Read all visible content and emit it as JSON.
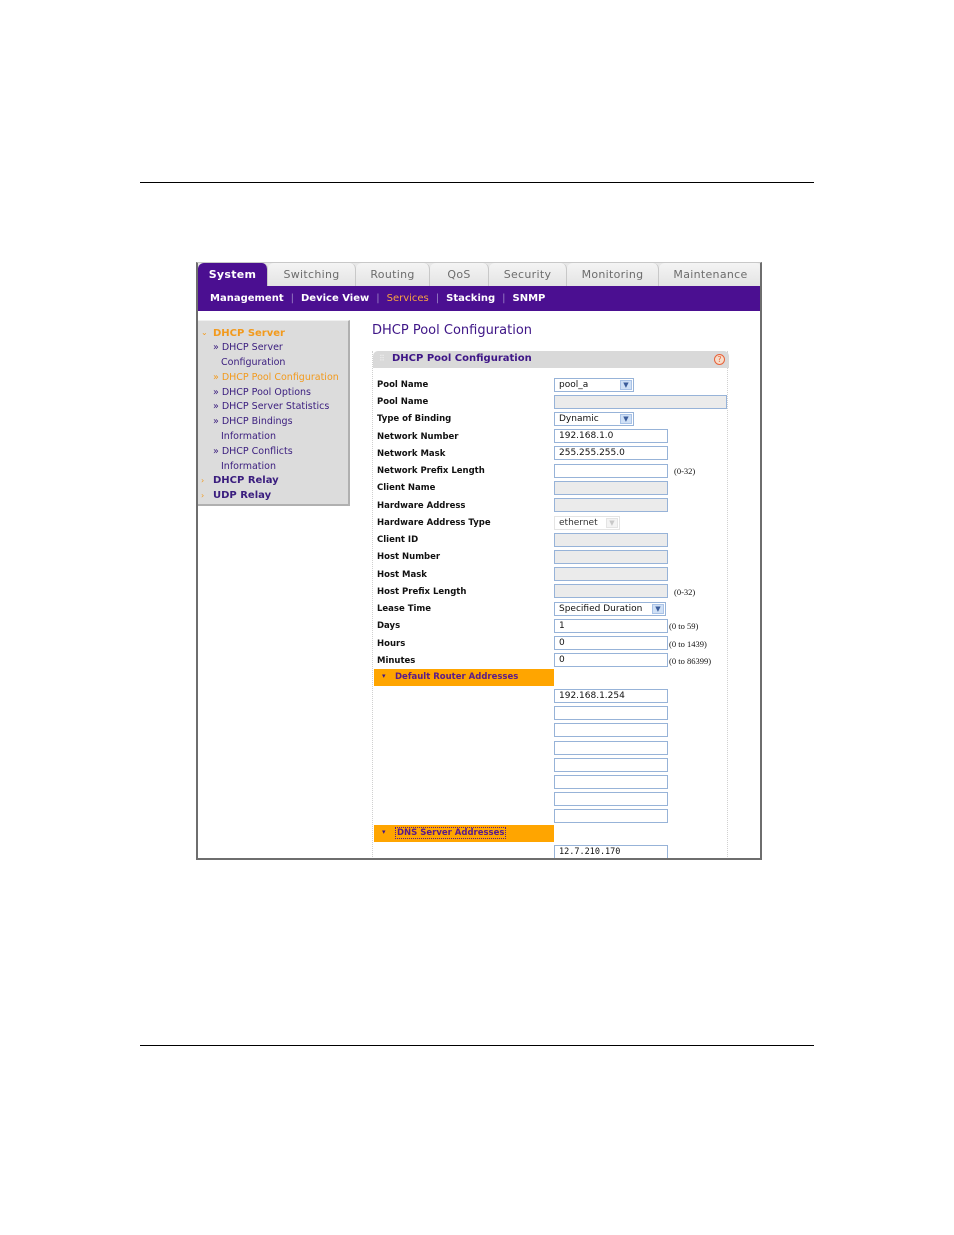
{
  "tabs": [
    {
      "label": "System",
      "active": true
    },
    {
      "label": "Switching",
      "active": false
    },
    {
      "label": "Routing",
      "active": false
    },
    {
      "label": "QoS",
      "active": false
    },
    {
      "label": "Security",
      "active": false
    },
    {
      "label": "Monitoring",
      "active": false
    },
    {
      "label": "Maintenance",
      "active": false
    }
  ],
  "subnav": [
    {
      "label": "Management",
      "active": false
    },
    {
      "label": "Device View",
      "active": false
    },
    {
      "label": "Services",
      "active": true
    },
    {
      "label": "Stacking",
      "active": false
    },
    {
      "label": "SNMP",
      "active": false
    }
  ],
  "sidebar": {
    "dhcp_server": "DHCP Server",
    "items": [
      {
        "label": "» DHCP Server"
      },
      {
        "label": "Configuration"
      },
      {
        "label": "» DHCP Pool Configuration"
      },
      {
        "label": "» DHCP Pool Options"
      },
      {
        "label": "» DHCP Server Statistics"
      },
      {
        "label": "» DHCP Bindings"
      },
      {
        "label": "Information"
      },
      {
        "label": "» DHCP Conflicts"
      },
      {
        "label": "Information"
      }
    ],
    "dhcp_relay": "DHCP Relay",
    "udp_relay": "UDP Relay"
  },
  "content": {
    "page_title": "DHCP Pool Configuration",
    "panel_title": "DHCP Pool Configuration",
    "help": "?",
    "fields": {
      "pool_name_select": {
        "label": "Pool Name",
        "value": "pool_a"
      },
      "pool_name_input": {
        "label": "Pool Name",
        "value": ""
      },
      "type_of_binding": {
        "label": "Type of Binding",
        "value": "Dynamic"
      },
      "network_number": {
        "label": "Network Number",
        "value": "192.168.1.0"
      },
      "network_mask": {
        "label": "Network Mask",
        "value": "255.255.255.0"
      },
      "network_prefix_length": {
        "label": "Network Prefix Length",
        "value": "",
        "hint": "(0-32)"
      },
      "client_name": {
        "label": "Client Name",
        "value": ""
      },
      "hardware_address": {
        "label": "Hardware Address",
        "value": ""
      },
      "hardware_address_type": {
        "label": "Hardware Address Type",
        "value": "ethernet"
      },
      "client_id": {
        "label": "Client ID",
        "value": ""
      },
      "host_number": {
        "label": "Host Number",
        "value": ""
      },
      "host_mask": {
        "label": "Host Mask",
        "value": ""
      },
      "host_prefix_length": {
        "label": "Host Prefix Length",
        "value": "",
        "hint": "(0-32)"
      },
      "lease_time": {
        "label": "Lease Time",
        "value": "Specified Duration"
      },
      "days": {
        "label": "Days",
        "value": "1",
        "hint": "(0 to 59)"
      },
      "hours": {
        "label": "Hours",
        "value": "0",
        "hint": "(0 to 1439)"
      },
      "minutes": {
        "label": "Minutes",
        "value": "0",
        "hint": "(0 to 86399)"
      }
    },
    "default_router": {
      "title": "Default Router Addresses",
      "addresses": [
        "192.168.1.254",
        "",
        "",
        "",
        "",
        "",
        "",
        ""
      ]
    },
    "dns_server": {
      "title": "DNS Server Addresses",
      "addresses": [
        "12.7.210.170"
      ]
    }
  }
}
